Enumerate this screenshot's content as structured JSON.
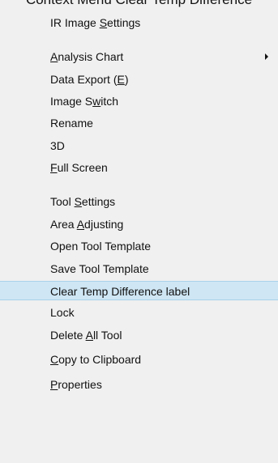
{
  "cut_title": "Context Menu Clear Temp Difference",
  "menu": {
    "items": [
      {
        "pre": "IR Image ",
        "u": "S",
        "post": "ettings"
      },
      {
        "pre": "",
        "u": "A",
        "post": "nalysis Chart"
      },
      {
        "pre": "Data Export (",
        "u": "E",
        "post": ")"
      },
      {
        "pre": "Image S",
        "u": "w",
        "post": "itch"
      },
      {
        "pre": "Rename",
        "u": "",
        "post": ""
      },
      {
        "pre": "3D",
        "u": "",
        "post": ""
      },
      {
        "pre": "",
        "u": "F",
        "post": "ull Screen"
      },
      {
        "pre": "Tool ",
        "u": "S",
        "post": "ettings"
      },
      {
        "pre": "Area ",
        "u": "A",
        "post": "djusting"
      },
      {
        "pre": "Open Tool  Template",
        "u": "",
        "post": ""
      },
      {
        "pre": "Save Tool  Template",
        "u": "",
        "post": ""
      },
      {
        "pre": "Clear Temp Difference label",
        "u": "",
        "post": ""
      },
      {
        "pre": "Lock",
        "u": "",
        "post": ""
      },
      {
        "pre": "Delete ",
        "u": "A",
        "post": "ll Tool"
      },
      {
        "pre": "",
        "u": "C",
        "post": "opy to Clipboard"
      },
      {
        "pre": "",
        "u": "P",
        "post": "roperties"
      }
    ]
  },
  "colors": {
    "menu_background": "#f0f0f0",
    "highlight_background": "#cfe6f4",
    "highlight_border": "#a9d2ea",
    "text": "#111111"
  }
}
